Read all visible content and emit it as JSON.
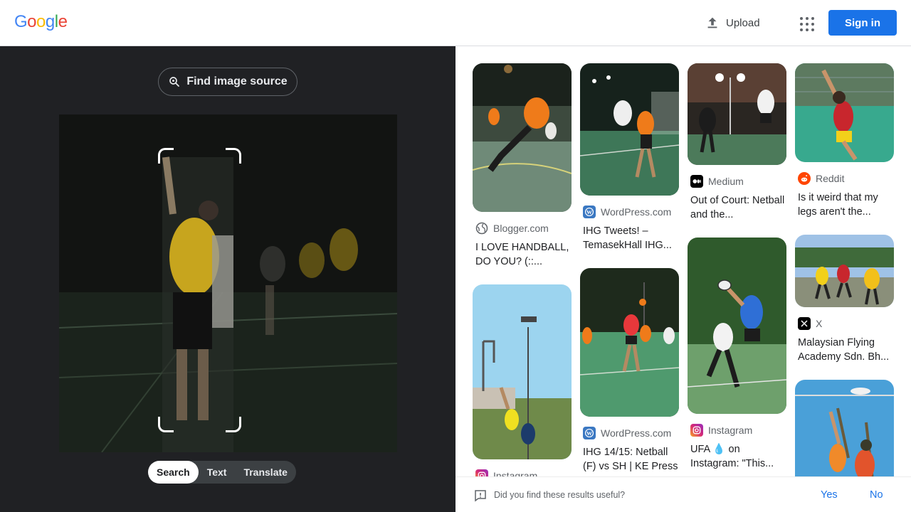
{
  "brand": {
    "logo_letters": [
      "G",
      "o",
      "o",
      "g",
      "l",
      "e"
    ],
    "logo_colors": [
      "#4285f4",
      "#ea4335",
      "#fbbc05",
      "#4285f4",
      "#34a853",
      "#ea4335"
    ]
  },
  "header": {
    "upload_label": "Upload",
    "apps_icon": "apps-grid-icon",
    "signin_label": "Sign in",
    "accent": "#1a73e8"
  },
  "query": {
    "find_source_label": "Find image source",
    "tabs": [
      "Search",
      "Text",
      "Translate"
    ],
    "active_tab": "Search"
  },
  "results": [
    {
      "source": "Blogger.com",
      "title": "I LOVE HANDBALL, DO YOU? (::...",
      "favicon": "globe-icon"
    },
    {
      "source": "Instagram",
      "title": "",
      "favicon": "instagram-icon"
    },
    {
      "source": "WordPress.com",
      "title": "IHG Tweets! – TemasekHall IHG...",
      "favicon": "wordpress-icon"
    },
    {
      "source": "WordPress.com",
      "title": "IHG 14/15: Netball (F) vs SH | KE Press",
      "favicon": "wordpress-icon"
    },
    {
      "source": "Medium",
      "title": "Out of Court: Netball and the...",
      "favicon": "medium-icon"
    },
    {
      "source": "Instagram",
      "title": "UFA 💧 on Instagram: \"This...",
      "favicon": "instagram-icon"
    },
    {
      "source": "Reddit",
      "title": "Is it weird that my legs aren't the...",
      "favicon": "reddit-icon"
    },
    {
      "source": "X",
      "title": "Malaysian Flying Academy Sdn. Bh...",
      "favicon": "x-icon"
    }
  ],
  "feedback": {
    "question": "Did you find these results useful?",
    "yes": "Yes",
    "no": "No"
  }
}
